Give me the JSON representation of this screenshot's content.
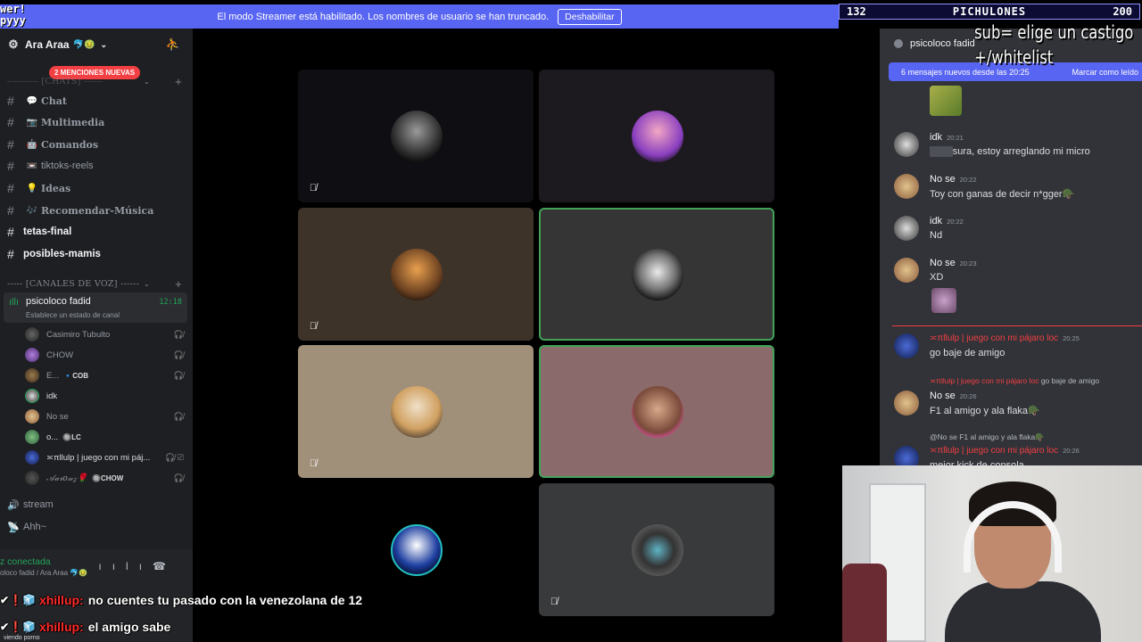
{
  "overlay_logo": "wer!\npyyy",
  "banner": {
    "message": "El modo Streamer está habilitado. Los nombres de usuario se han truncado.",
    "button": "Deshabilitar"
  },
  "counter": {
    "left": "132",
    "title": "PICHULONES",
    "right": "200"
  },
  "sub_text": "sub= elige un castigo\n+/whitelist",
  "sidebar": {
    "server_name": "Ara Araa",
    "server_emoji": "🐬🤢",
    "mentions_badge": "2 MENCIONES NUEVAS",
    "category_chats": "---------- [CHATS] ------",
    "channels": [
      {
        "icon": "💬",
        "name": "Chat"
      },
      {
        "icon": "📷",
        "name": "Multimedia"
      },
      {
        "icon": "🤖",
        "name": "Comandos"
      },
      {
        "icon": "📼",
        "name": "tiktoks-reels"
      },
      {
        "icon": "💡",
        "name": "Ideas"
      },
      {
        "icon": "🎶",
        "name": "Recomendar-Música"
      }
    ],
    "plain_channels": [
      "tetas-final",
      "posibles-mamis"
    ],
    "category_voice": "----- [CANALES DE VOZ] ------",
    "voice_channel": {
      "name": "psicoloco fadid",
      "time": "12:18",
      "status": "Establece un estado de canal"
    },
    "voice_users": [
      {
        "name": "Casimiro Tubulto",
        "tag": ""
      },
      {
        "name": "CHOW",
        "tag": ""
      },
      {
        "name": "E...",
        "tag": "🔹COB"
      },
      {
        "name": "idk",
        "tag": ""
      },
      {
        "name": "No se",
        "tag": ""
      },
      {
        "name": "o...",
        "tag": "🔘LC"
      },
      {
        "name": "≍πllulp | juego con mi páj...",
        "tag": ""
      },
      {
        "name": "𝒜𝒶𝓇𝑜𝓃𝓏🌹",
        "tag": "🔘CHOW"
      }
    ],
    "other_voice": [
      "stream",
      "Ahh~"
    ],
    "connection_status": "z conectada",
    "connection_sub": "oloco fadid / Ara Araa 🐬🤢"
  },
  "chat": {
    "channel_name": "psicoloco fadid",
    "new_messages": "6 mensajes nuevos desde las 20:25",
    "mark_read": "Marcar como leído",
    "messages": [
      {
        "author": "idk",
        "time": "20:21",
        "text": "sura, estoy arreglando mi micro",
        "prefix": "De lo"
      },
      {
        "author": "No se",
        "time": "20:22",
        "text": "Toy con ganas de decir n*gger🪖"
      },
      {
        "author": "idk",
        "time": "20:22",
        "text": "Nd"
      },
      {
        "author": "No se",
        "time": "20:23",
        "text": "XD"
      },
      {
        "author": "≍πllulp | juego con mi pájaro loc",
        "time": "20:25",
        "text": "go baje de amigo"
      },
      {
        "author": "No se",
        "time": "20:26",
        "text": "F1 al amigo y ala flaka🪖",
        "reply_author": "≍πllulp | juego con mi pájaro loc",
        "reply_text": "go baje de amigo"
      },
      {
        "author": "≍πllulp | juego con mi pájaro loc",
        "time": "20:26",
        "text": "mejor kick de consola",
        "reply_author": "@No se",
        "reply_text": "F1 al amigo y ala flaka🪖"
      }
    ]
  },
  "stream_chat": [
    {
      "badges": "✔❗🧊",
      "user": "xhillup:",
      "text": "no cuentes tu pasado con la venezolana de 12"
    },
    {
      "badges": "✔❗🧊",
      "user": "xhillup:",
      "text": "el amigo sabe"
    }
  ],
  "viewing": "viendo porno",
  "colors": {
    "accent": "#5865f2",
    "speaking": "#43a25a",
    "danger": "#f23f43",
    "sidebar_bg": "#1e1f22",
    "chat_bg": "#313338"
  }
}
